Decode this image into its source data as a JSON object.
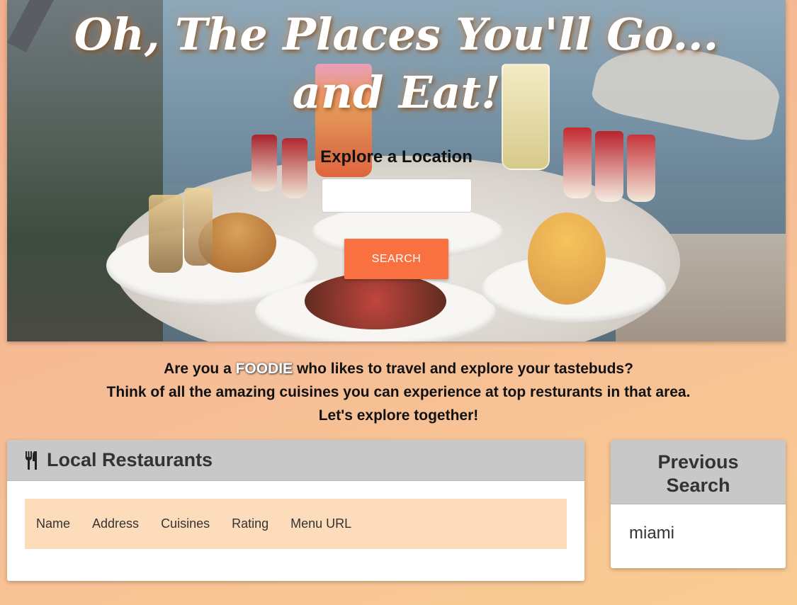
{
  "hero": {
    "title_line1": "Oh, The Places You'll Go...",
    "title_line2": "and Eat!",
    "explore_label": "Explore a Location",
    "search_value": "",
    "search_button": "SEARCH"
  },
  "tagline": {
    "line1_before": "Are you a",
    "line1_highlight": "FOODIE",
    "line1_after": "who likes to travel and explore your tastebuds?",
    "line2": "Think of all the amazing cuisines you can experience at top resturants in that area.",
    "line3": "Let's explore together!"
  },
  "restaurants": {
    "title": "Local Restaurants",
    "icon": "fork-knife-icon",
    "columns": [
      "Name",
      "Address",
      "Cuisines",
      "Rating",
      "Menu URL"
    ]
  },
  "previous": {
    "title_line1": "Previous",
    "title_line2": "Search",
    "items": [
      "miami"
    ]
  },
  "colors": {
    "accent": "#f97141",
    "table_header_bg": "#fddcbb",
    "card_header_bg": "#c8c8c8"
  }
}
